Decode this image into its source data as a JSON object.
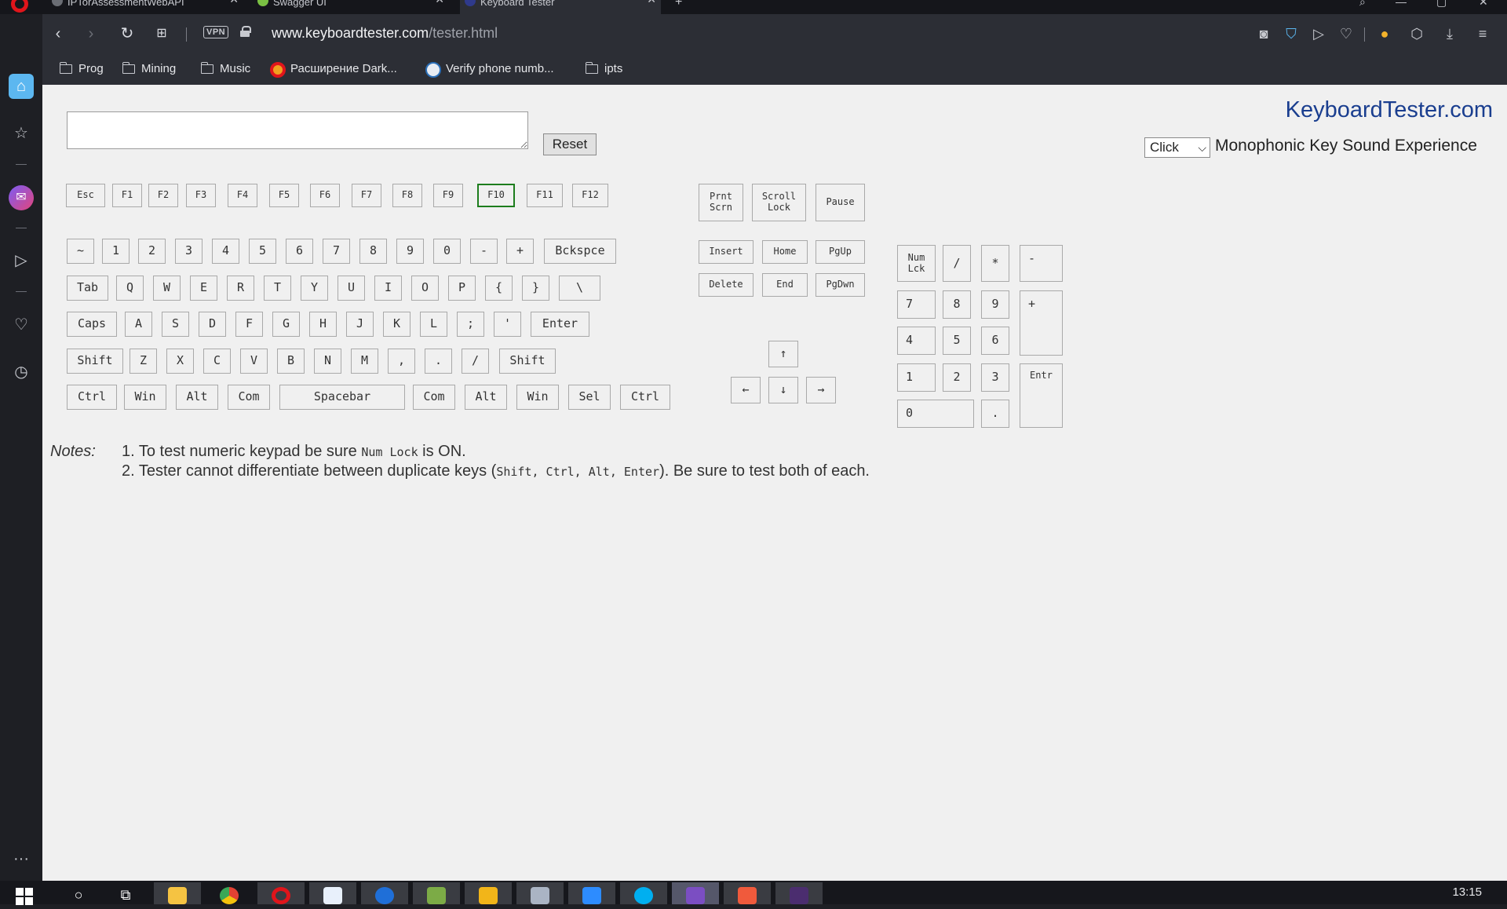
{
  "browser": {
    "tabs": [
      {
        "label": "IPTorAssessmentWebAPI"
      },
      {
        "label": "Swagger UI"
      },
      {
        "label": "Keyboard Tester"
      }
    ],
    "url_domain": "www.keyboardtester.com",
    "url_path": "/tester.html",
    "vpn_label": "VPN",
    "bookmarks": [
      {
        "label": "Prog",
        "icon": "folder-icon"
      },
      {
        "label": "Mining",
        "icon": "folder-icon"
      },
      {
        "label": "Music",
        "icon": "folder-icon"
      },
      {
        "label": "Расширение Dark...",
        "icon": "opera-icon"
      },
      {
        "label": "Verify phone numb...",
        "icon": "phone-icon"
      },
      {
        "label": "ipts",
        "icon": "folder-icon"
      }
    ]
  },
  "page": {
    "brand": "KeyboardTester.com",
    "reset_label": "Reset",
    "sound_select_value": "Click",
    "sound_label": "Monophonic Key Sound Experience",
    "input_value": ""
  },
  "keys": {
    "fn_row": [
      "Esc",
      "F1",
      "F2",
      "F3",
      "F4",
      "F5",
      "F6",
      "F7",
      "F8",
      "F9",
      "F10",
      "F11",
      "F12"
    ],
    "row1": [
      "~",
      "1",
      "2",
      "3",
      "4",
      "5",
      "6",
      "7",
      "8",
      "9",
      "0",
      "-",
      "+",
      "Bckspce"
    ],
    "row2": [
      "Tab",
      "Q",
      "W",
      "E",
      "R",
      "T",
      "Y",
      "U",
      "I",
      "O",
      "P",
      "{",
      "}",
      "\\"
    ],
    "row3": [
      "Caps",
      "A",
      "S",
      "D",
      "F",
      "G",
      "H",
      "J",
      "K",
      "L",
      ";",
      "'",
      "Enter"
    ],
    "row4": [
      "Shift",
      "Z",
      "X",
      "C",
      "V",
      "B",
      "N",
      "M",
      ",",
      ".",
      "/",
      "Shift"
    ],
    "row5": [
      "Ctrl",
      "Win",
      "Alt",
      "Com",
      "Spacebar",
      "Com",
      "Alt",
      "Win",
      "Sel",
      "Ctrl"
    ],
    "system": [
      "Prnt\nScrn",
      "Scroll\nLock",
      "Pause"
    ],
    "nav": [
      "Insert",
      "Home",
      "PgUp",
      "Delete",
      "End",
      "PgDwn"
    ],
    "arrows": [
      "↑",
      "←",
      "↓",
      "→"
    ],
    "numpad": {
      "numlock": "Num\nLck",
      "divide": "/",
      "multiply": "*",
      "minus": "-",
      "n7": "7",
      "n8": "8",
      "n9": "9",
      "plus": "+",
      "n4": "4",
      "n5": "5",
      "n6": "6",
      "n1": "1",
      "n2": "2",
      "n3": "3",
      "enter": "Entr",
      "n0": "0",
      "dot": "."
    },
    "active_key": "F10"
  },
  "notes": {
    "label": "Notes:",
    "note1_pre": "1. To test numeric keypad be sure ",
    "note1_code": "Num Lock",
    "note1_post": " is ON.",
    "note2_pre": "2. Tester cannot differentiate between duplicate keys (",
    "note2_code": "Shift, Ctrl, Alt, Enter",
    "note2_post": "). Be sure to test both of each."
  },
  "taskbar": {
    "clock": "13:15"
  },
  "colors": {
    "brand": "#1a3e8f",
    "active_key_border": "#1d7d1d",
    "browser_chrome": "#2c2e35"
  }
}
